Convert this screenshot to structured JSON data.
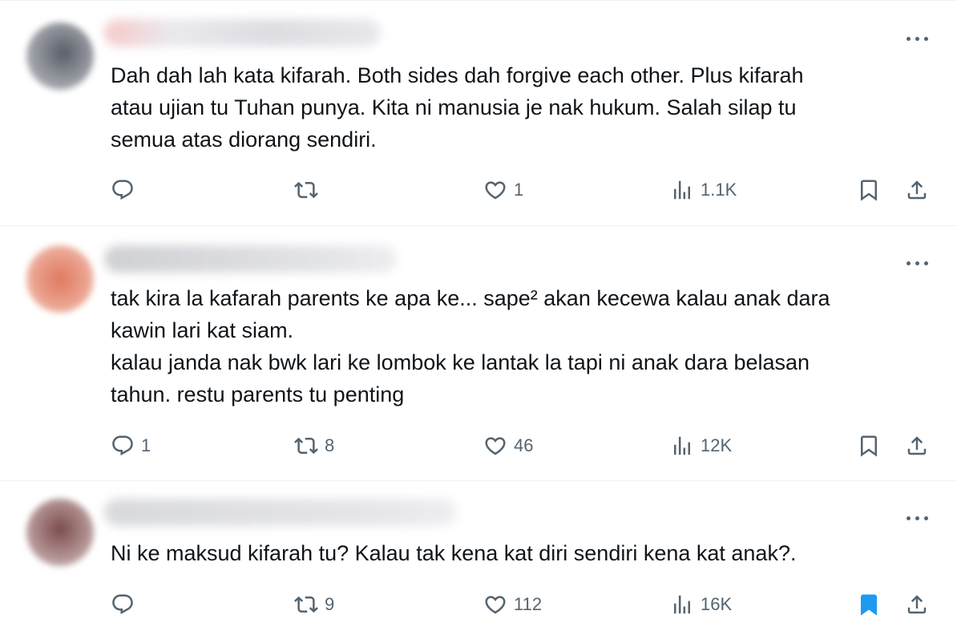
{
  "icons": {
    "more": "more-horizontal-icon",
    "reply": "reply-icon",
    "retweet": "retweet-icon",
    "like": "heart-icon",
    "views": "analytics-icon",
    "bookmark": "bookmark-icon",
    "share": "share-icon"
  },
  "colors": {
    "text": "#0f1419",
    "secondary": "#536471",
    "accent": "#1d9bf0",
    "divider": "#eff3f4"
  },
  "tweets": [
    {
      "text": "Dah dah lah kata kifarah. Both sides dah forgive each other. Plus kifarah\natau ujian tu Tuhan punya. Kita ni manusia je nak hukum. Salah silap tu\nsemua atas diorang sendiri.",
      "replies": "",
      "retweets": "",
      "likes": "1",
      "views": "1.1K",
      "bookmarked": false
    },
    {
      "text": "tak kira la kafarah parents ke apa ke... sape² akan kecewa kalau anak dara\nkawin lari kat siam.\nkalau janda nak bwk lari ke lombok ke lantak la tapi ni anak dara belasan\ntahun. restu parents tu penting",
      "replies": "1",
      "retweets": "8",
      "likes": "46",
      "views": "12K",
      "bookmarked": false
    },
    {
      "text": "Ni ke maksud kifarah tu? Kalau tak kena kat diri sendiri kena kat anak?.",
      "replies": "",
      "retweets": "9",
      "likes": "112",
      "views": "16K",
      "bookmarked": true
    }
  ]
}
